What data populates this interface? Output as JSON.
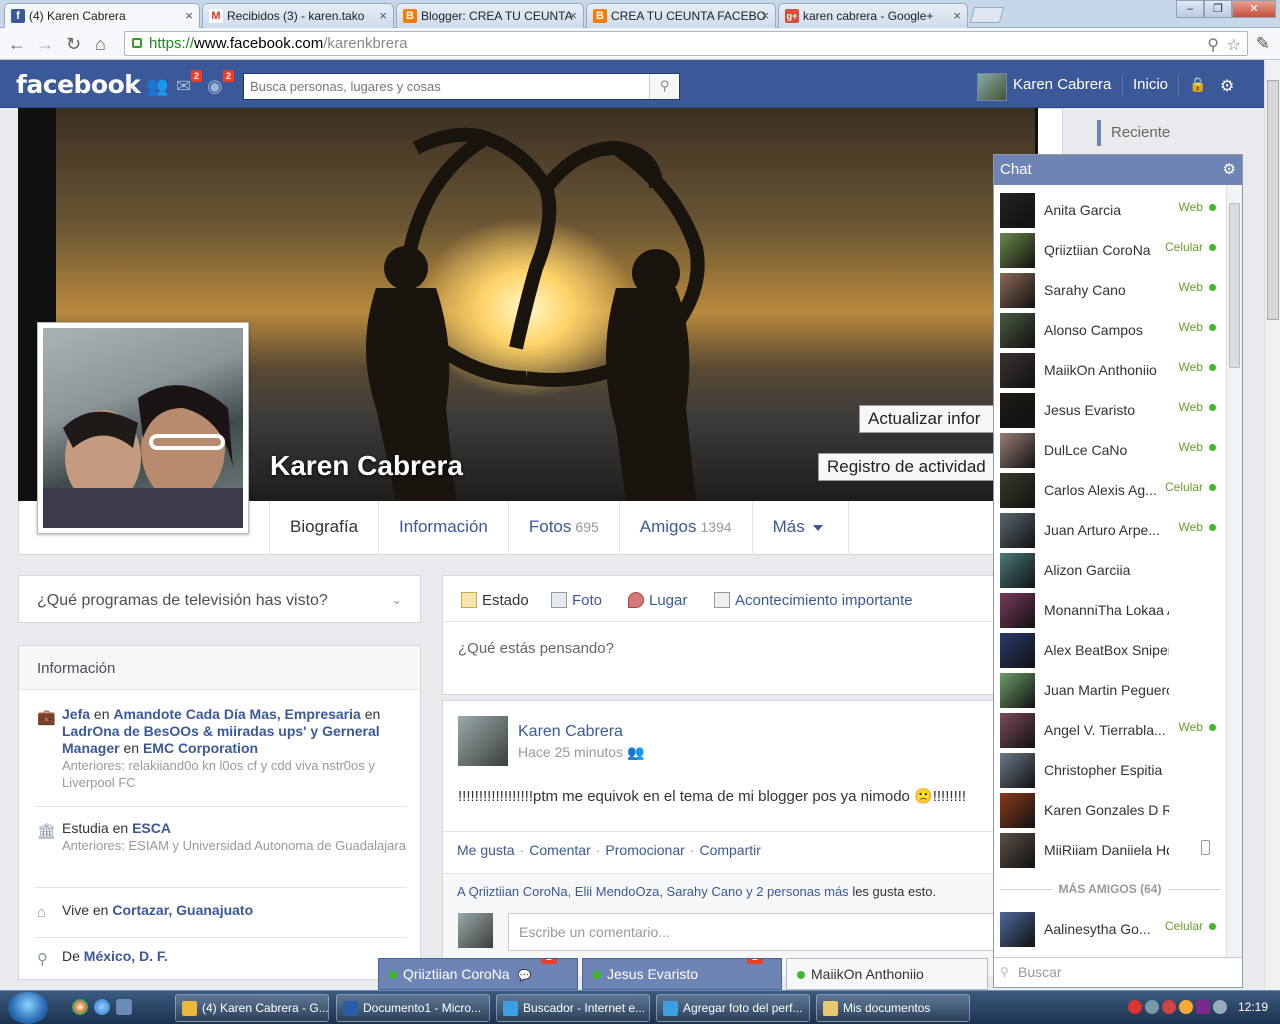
{
  "browser": {
    "tabs": [
      {
        "title": "(4) Karen Cabrera",
        "icon": "facebook-icon",
        "color": "#3b5998",
        "glyph": "f",
        "active": true
      },
      {
        "title": "Recibidos (3) - karen.tako",
        "icon": "gmail-icon",
        "color": "#d93025",
        "glyph": "M",
        "active": false
      },
      {
        "title": "Blogger: CREA TU CEUNTA",
        "icon": "blogger-icon",
        "color": "#f57d00",
        "glyph": "B",
        "active": false
      },
      {
        "title": "CREA TU CEUNTA FACEBO",
        "icon": "blogger-icon",
        "color": "#f57d00",
        "glyph": "B",
        "active": false
      },
      {
        "title": "karen cabrera - Google+",
        "icon": "google-plus-icon",
        "color": "#dd4b39",
        "glyph": "g+",
        "active": false
      }
    ],
    "url_scheme": "https://",
    "url_host": "www.facebook.com",
    "url_path": "/karenkbrera"
  },
  "fbbar": {
    "logo": "facebook",
    "friend_requests_badge": "",
    "messages_badge": "2",
    "notifications_badge": "2",
    "search_placeholder": "Busca personas, lugares y cosas",
    "user_name": "Karen Cabrera",
    "home_label": "Inicio"
  },
  "profile": {
    "name": "Karen Cabrera",
    "update_info_button": "Actualizar infor",
    "activity_log_button": "Registro de actividad",
    "tabs": [
      {
        "label": "Biografía",
        "count": ""
      },
      {
        "label": "Información",
        "count": ""
      },
      {
        "label": "Fotos",
        "count": "695"
      },
      {
        "label": "Amigos",
        "count": "1394"
      },
      {
        "label": "Más",
        "count": ""
      }
    ]
  },
  "left": {
    "tv_question": "¿Qué programas de televisión has visto?",
    "info_title": "Información",
    "work": {
      "role": "Jefa",
      "at": "en",
      "company": "Amandote Cada Día Mas, Empresaria",
      "en2": "en",
      "company2": "LadrOna de BesOOs & miiradas ups' y Gerneral Manager",
      "en3": "en",
      "company3": "EMC Corporation",
      "previous": "Anteriores: relakiiand0o kn l0os cf y cdd viva nstr0os y Liverpool FC"
    },
    "study": {
      "label": "Estudia en",
      "school": "ESCA",
      "previous": "Anteriores: ESIAM y Universidad Autonoma de Guadalajara"
    },
    "lives": {
      "label": "Vive en",
      "place": "Cortazar, Guanajuato"
    },
    "from": {
      "label": "De",
      "place": "México, D. F."
    }
  },
  "composer": {
    "status": "Estado",
    "photo": "Foto",
    "place": "Lugar",
    "event": "Acontecimiento importante",
    "placeholder": "¿Qué estás pensando?"
  },
  "post": {
    "author": "Karen Cabrera",
    "time": "Hace 25 minutos",
    "body": "!!!!!!!!!!!!!!!!!!ptm me equivok en el tema de mi blogger pos ya nimodo 🙁!!!!!!!!",
    "like": "Me gusta",
    "comment": "Comentar",
    "promote": "Promocionar",
    "share": "Compartir",
    "likes_prefix": "A",
    "likes_names": "Qriiztiian CoroNa, Elii MendoOza, Sarahy Cano",
    "likes_and": "y",
    "likes_more": "2 personas más",
    "likes_suffix": "les gusta esto.",
    "comment_placeholder": "Escribe un comentario..."
  },
  "recent": {
    "label": "Reciente"
  },
  "chat": {
    "title": "Chat",
    "friends": [
      {
        "name": "Anita Garcia",
        "status": "Web",
        "color": "#222"
      },
      {
        "name": "Qriiztiian CoroNa",
        "status": "Celular",
        "color": "#6a8a4a"
      },
      {
        "name": "Sarahy Cano",
        "status": "Web",
        "color": "#8a6a55"
      },
      {
        "name": "Alonso Campos",
        "status": "Web",
        "color": "#4a5a40"
      },
      {
        "name": "MaiikOn Anthoniio",
        "status": "Web",
        "color": "#3a3230"
      },
      {
        "name": "Jesus Evaristo",
        "status": "Web",
        "color": "#1f1a15"
      },
      {
        "name": "DulLce CaNo",
        "status": "Web",
        "color": "#9a7f7a"
      },
      {
        "name": "Carlos Alexis Ag...",
        "status": "Celular",
        "color": "#3a3a2a"
      },
      {
        "name": "Juan Arturo Arpe...",
        "status": "Web",
        "color": "#5a6870"
      },
      {
        "name": "Alizon Garciia",
        "status": "",
        "color": "#4a7a7a"
      },
      {
        "name": "MonanniTha Lokaa A",
        "status": "",
        "color": "#7a3a5a"
      },
      {
        "name": "Alex BeatBox Sniper",
        "status": "",
        "color": "#2a3a6a"
      },
      {
        "name": "Juan Martin Peguero",
        "status": "",
        "color": "#6aa06a"
      },
      {
        "name": "Angel V. Tierrabla...",
        "status": "Web",
        "color": "#7a4a5a"
      },
      {
        "name": "Christopher Espitia",
        "status": "",
        "color": "#6a7a8a"
      },
      {
        "name": "Karen Gonzales D Riico",
        "status": "",
        "color": "#8a3a1a"
      },
      {
        "name": "MiiRiiam Daniiela Hdz",
        "status": "mobile",
        "color": "#5a5048"
      }
    ],
    "more_friends": "MÁS AMIGOS (64)",
    "more_friend": {
      "name": "Aalinesytha Go...",
      "status": "Celular",
      "color": "#4a6a9a"
    },
    "search_placeholder": "Buscar"
  },
  "chat_tabs": [
    {
      "name": "Qriiztiian CoroNa",
      "badge": "1"
    },
    {
      "name": "Jesus Evaristo",
      "badge": "1"
    },
    {
      "name": "MaiikOn Anthoniio",
      "badge": ""
    }
  ],
  "taskbar": {
    "items": [
      {
        "label": "(4) Karen Cabrera - G...",
        "color": "#e8b83a"
      },
      {
        "label": "Documento1 - Micro...",
        "color": "#2b5ca8"
      },
      {
        "label": "Buscador - Internet e...",
        "color": "#3aa0e0"
      },
      {
        "label": "Agregar foto del perf...",
        "color": "#3aa0e0"
      },
      {
        "label": "Mis documentos",
        "color": "#e8c870"
      }
    ],
    "clock": "12:19"
  }
}
